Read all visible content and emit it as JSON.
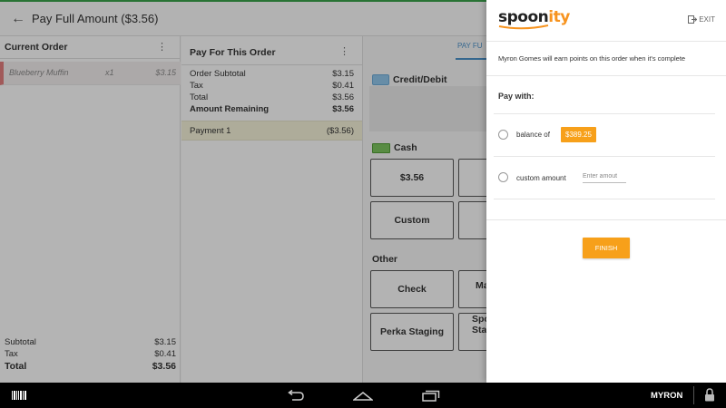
{
  "appbar": {
    "title": "Pay Full Amount ($3.56)"
  },
  "current_order": {
    "title": "Current Order",
    "items": [
      {
        "name": "Blueberry Muffin",
        "qty": "x1",
        "price": "$3.15"
      }
    ],
    "subtotal_label": "Subtotal",
    "subtotal": "$3.15",
    "tax_label": "Tax",
    "tax": "$0.41",
    "total_label": "Total",
    "total": "$3.56"
  },
  "pay_for_order": {
    "title": "Pay For This Order",
    "order_subtotal_label": "Order Subtotal",
    "order_subtotal": "$3.15",
    "tax_label": "Tax",
    "tax": "$0.41",
    "total_label": "Total",
    "total": "$3.56",
    "remaining_label": "Amount Remaining",
    "remaining": "$3.56",
    "payments": [
      {
        "name": "Payment 1",
        "amount": "($3.56)"
      }
    ]
  },
  "payment_methods": {
    "tab_partial": "PAY FU",
    "credit_label": "Credit/Debit",
    "cash_label": "Cash",
    "cash_buttons": [
      "$3.56",
      "Custom"
    ],
    "other_label": "Other",
    "other_buttons": [
      "Check",
      "Perka Staging"
    ],
    "other_partial": [
      "Ma",
      "Spo",
      "Stag"
    ]
  },
  "spoonity": {
    "logo_prefix": "spoon",
    "logo_accent": "ity",
    "exit_label": "EXIT",
    "earn_message": "Myron Gomes will earn points on this order when it's complete",
    "pay_with": "Pay with:",
    "balance_label": "balance of",
    "balance_value": "$389.25",
    "custom_amount_label": "custom amount",
    "custom_amount_placeholder": "Enter amout",
    "finish_label": "FINISH",
    "accent_color": "#f7a01a"
  },
  "navbar": {
    "user": "MYRON"
  }
}
